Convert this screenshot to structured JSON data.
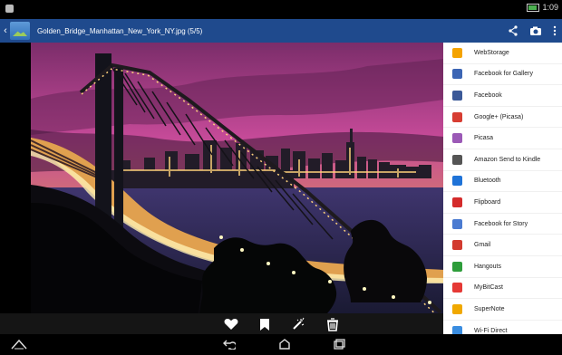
{
  "status_bar": {
    "time": "1:09"
  },
  "app_bar": {
    "title": "Golden_Bridge_Manhattan_New_York_NY.jpg (5/5)"
  },
  "share_menu": {
    "items": [
      {
        "label": "WebStorage",
        "icon": "webstorage-icon",
        "color": "#f4a300"
      },
      {
        "label": "Facebook for Gallery",
        "icon": "facebook-gallery-icon",
        "color": "#3c65b4"
      },
      {
        "label": "Facebook",
        "icon": "facebook-icon",
        "color": "#3b5998"
      },
      {
        "label": "Google+ (Picasa)",
        "icon": "google-plus-icon",
        "color": "#d73d32"
      },
      {
        "label": "Picasa",
        "icon": "picasa-icon",
        "color": "#9b59b6"
      },
      {
        "label": "Amazon Send to Kindle",
        "icon": "kindle-icon",
        "color": "#555555"
      },
      {
        "label": "Bluetooth",
        "icon": "bluetooth-icon",
        "color": "#1f73d8"
      },
      {
        "label": "Flipboard",
        "icon": "flipboard-icon",
        "color": "#d42b2b"
      },
      {
        "label": "Facebook for Story",
        "icon": "facebook-story-icon",
        "color": "#4b7bd1"
      },
      {
        "label": "Gmail",
        "icon": "gmail-icon",
        "color": "#d23b2f"
      },
      {
        "label": "Hangouts",
        "icon": "hangouts-icon",
        "color": "#2e9d3b"
      },
      {
        "label": "MyBitCast",
        "icon": "mybitcast-icon",
        "color": "#e53935"
      },
      {
        "label": "SuperNote",
        "icon": "supernote-icon",
        "color": "#f0a800"
      },
      {
        "label": "Wi-Fi Direct",
        "icon": "wifi-direct-icon",
        "color": "#3a8de0"
      }
    ]
  }
}
